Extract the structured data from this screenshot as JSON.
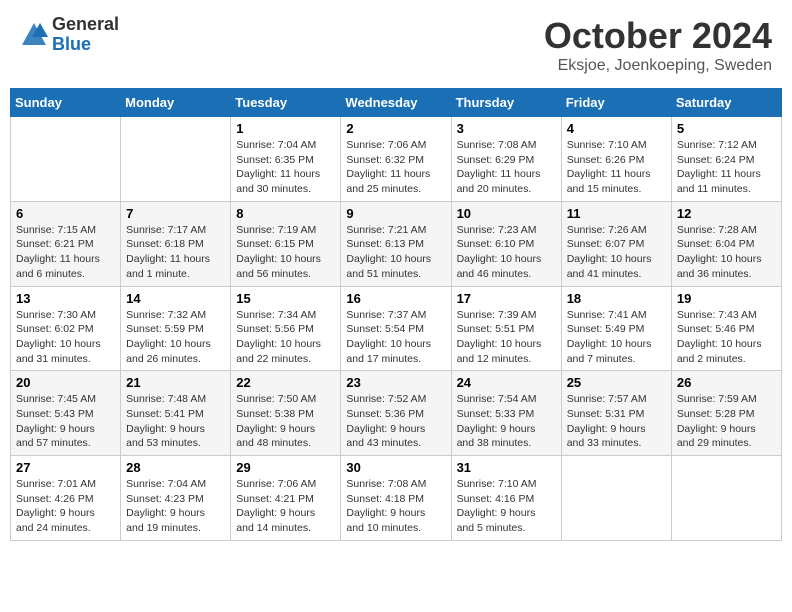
{
  "logo": {
    "general": "General",
    "blue": "Blue"
  },
  "title": "October 2024",
  "location": "Eksjoe, Joenkoeping, Sweden",
  "days_of_week": [
    "Sunday",
    "Monday",
    "Tuesday",
    "Wednesday",
    "Thursday",
    "Friday",
    "Saturday"
  ],
  "weeks": [
    [
      {
        "day": "",
        "info": ""
      },
      {
        "day": "",
        "info": ""
      },
      {
        "day": "1",
        "info": "Sunrise: 7:04 AM\nSunset: 6:35 PM\nDaylight: 11 hours and 30 minutes."
      },
      {
        "day": "2",
        "info": "Sunrise: 7:06 AM\nSunset: 6:32 PM\nDaylight: 11 hours and 25 minutes."
      },
      {
        "day": "3",
        "info": "Sunrise: 7:08 AM\nSunset: 6:29 PM\nDaylight: 11 hours and 20 minutes."
      },
      {
        "day": "4",
        "info": "Sunrise: 7:10 AM\nSunset: 6:26 PM\nDaylight: 11 hours and 15 minutes."
      },
      {
        "day": "5",
        "info": "Sunrise: 7:12 AM\nSunset: 6:24 PM\nDaylight: 11 hours and 11 minutes."
      }
    ],
    [
      {
        "day": "6",
        "info": "Sunrise: 7:15 AM\nSunset: 6:21 PM\nDaylight: 11 hours and 6 minutes."
      },
      {
        "day": "7",
        "info": "Sunrise: 7:17 AM\nSunset: 6:18 PM\nDaylight: 11 hours and 1 minute."
      },
      {
        "day": "8",
        "info": "Sunrise: 7:19 AM\nSunset: 6:15 PM\nDaylight: 10 hours and 56 minutes."
      },
      {
        "day": "9",
        "info": "Sunrise: 7:21 AM\nSunset: 6:13 PM\nDaylight: 10 hours and 51 minutes."
      },
      {
        "day": "10",
        "info": "Sunrise: 7:23 AM\nSunset: 6:10 PM\nDaylight: 10 hours and 46 minutes."
      },
      {
        "day": "11",
        "info": "Sunrise: 7:26 AM\nSunset: 6:07 PM\nDaylight: 10 hours and 41 minutes."
      },
      {
        "day": "12",
        "info": "Sunrise: 7:28 AM\nSunset: 6:04 PM\nDaylight: 10 hours and 36 minutes."
      }
    ],
    [
      {
        "day": "13",
        "info": "Sunrise: 7:30 AM\nSunset: 6:02 PM\nDaylight: 10 hours and 31 minutes."
      },
      {
        "day": "14",
        "info": "Sunrise: 7:32 AM\nSunset: 5:59 PM\nDaylight: 10 hours and 26 minutes."
      },
      {
        "day": "15",
        "info": "Sunrise: 7:34 AM\nSunset: 5:56 PM\nDaylight: 10 hours and 22 minutes."
      },
      {
        "day": "16",
        "info": "Sunrise: 7:37 AM\nSunset: 5:54 PM\nDaylight: 10 hours and 17 minutes."
      },
      {
        "day": "17",
        "info": "Sunrise: 7:39 AM\nSunset: 5:51 PM\nDaylight: 10 hours and 12 minutes."
      },
      {
        "day": "18",
        "info": "Sunrise: 7:41 AM\nSunset: 5:49 PM\nDaylight: 10 hours and 7 minutes."
      },
      {
        "day": "19",
        "info": "Sunrise: 7:43 AM\nSunset: 5:46 PM\nDaylight: 10 hours and 2 minutes."
      }
    ],
    [
      {
        "day": "20",
        "info": "Sunrise: 7:45 AM\nSunset: 5:43 PM\nDaylight: 9 hours and 57 minutes."
      },
      {
        "day": "21",
        "info": "Sunrise: 7:48 AM\nSunset: 5:41 PM\nDaylight: 9 hours and 53 minutes."
      },
      {
        "day": "22",
        "info": "Sunrise: 7:50 AM\nSunset: 5:38 PM\nDaylight: 9 hours and 48 minutes."
      },
      {
        "day": "23",
        "info": "Sunrise: 7:52 AM\nSunset: 5:36 PM\nDaylight: 9 hours and 43 minutes."
      },
      {
        "day": "24",
        "info": "Sunrise: 7:54 AM\nSunset: 5:33 PM\nDaylight: 9 hours and 38 minutes."
      },
      {
        "day": "25",
        "info": "Sunrise: 7:57 AM\nSunset: 5:31 PM\nDaylight: 9 hours and 33 minutes."
      },
      {
        "day": "26",
        "info": "Sunrise: 7:59 AM\nSunset: 5:28 PM\nDaylight: 9 hours and 29 minutes."
      }
    ],
    [
      {
        "day": "27",
        "info": "Sunrise: 7:01 AM\nSunset: 4:26 PM\nDaylight: 9 hours and 24 minutes."
      },
      {
        "day": "28",
        "info": "Sunrise: 7:04 AM\nSunset: 4:23 PM\nDaylight: 9 hours and 19 minutes."
      },
      {
        "day": "29",
        "info": "Sunrise: 7:06 AM\nSunset: 4:21 PM\nDaylight: 9 hours and 14 minutes."
      },
      {
        "day": "30",
        "info": "Sunrise: 7:08 AM\nSunset: 4:18 PM\nDaylight: 9 hours and 10 minutes."
      },
      {
        "day": "31",
        "info": "Sunrise: 7:10 AM\nSunset: 4:16 PM\nDaylight: 9 hours and 5 minutes."
      },
      {
        "day": "",
        "info": ""
      },
      {
        "day": "",
        "info": ""
      }
    ]
  ]
}
